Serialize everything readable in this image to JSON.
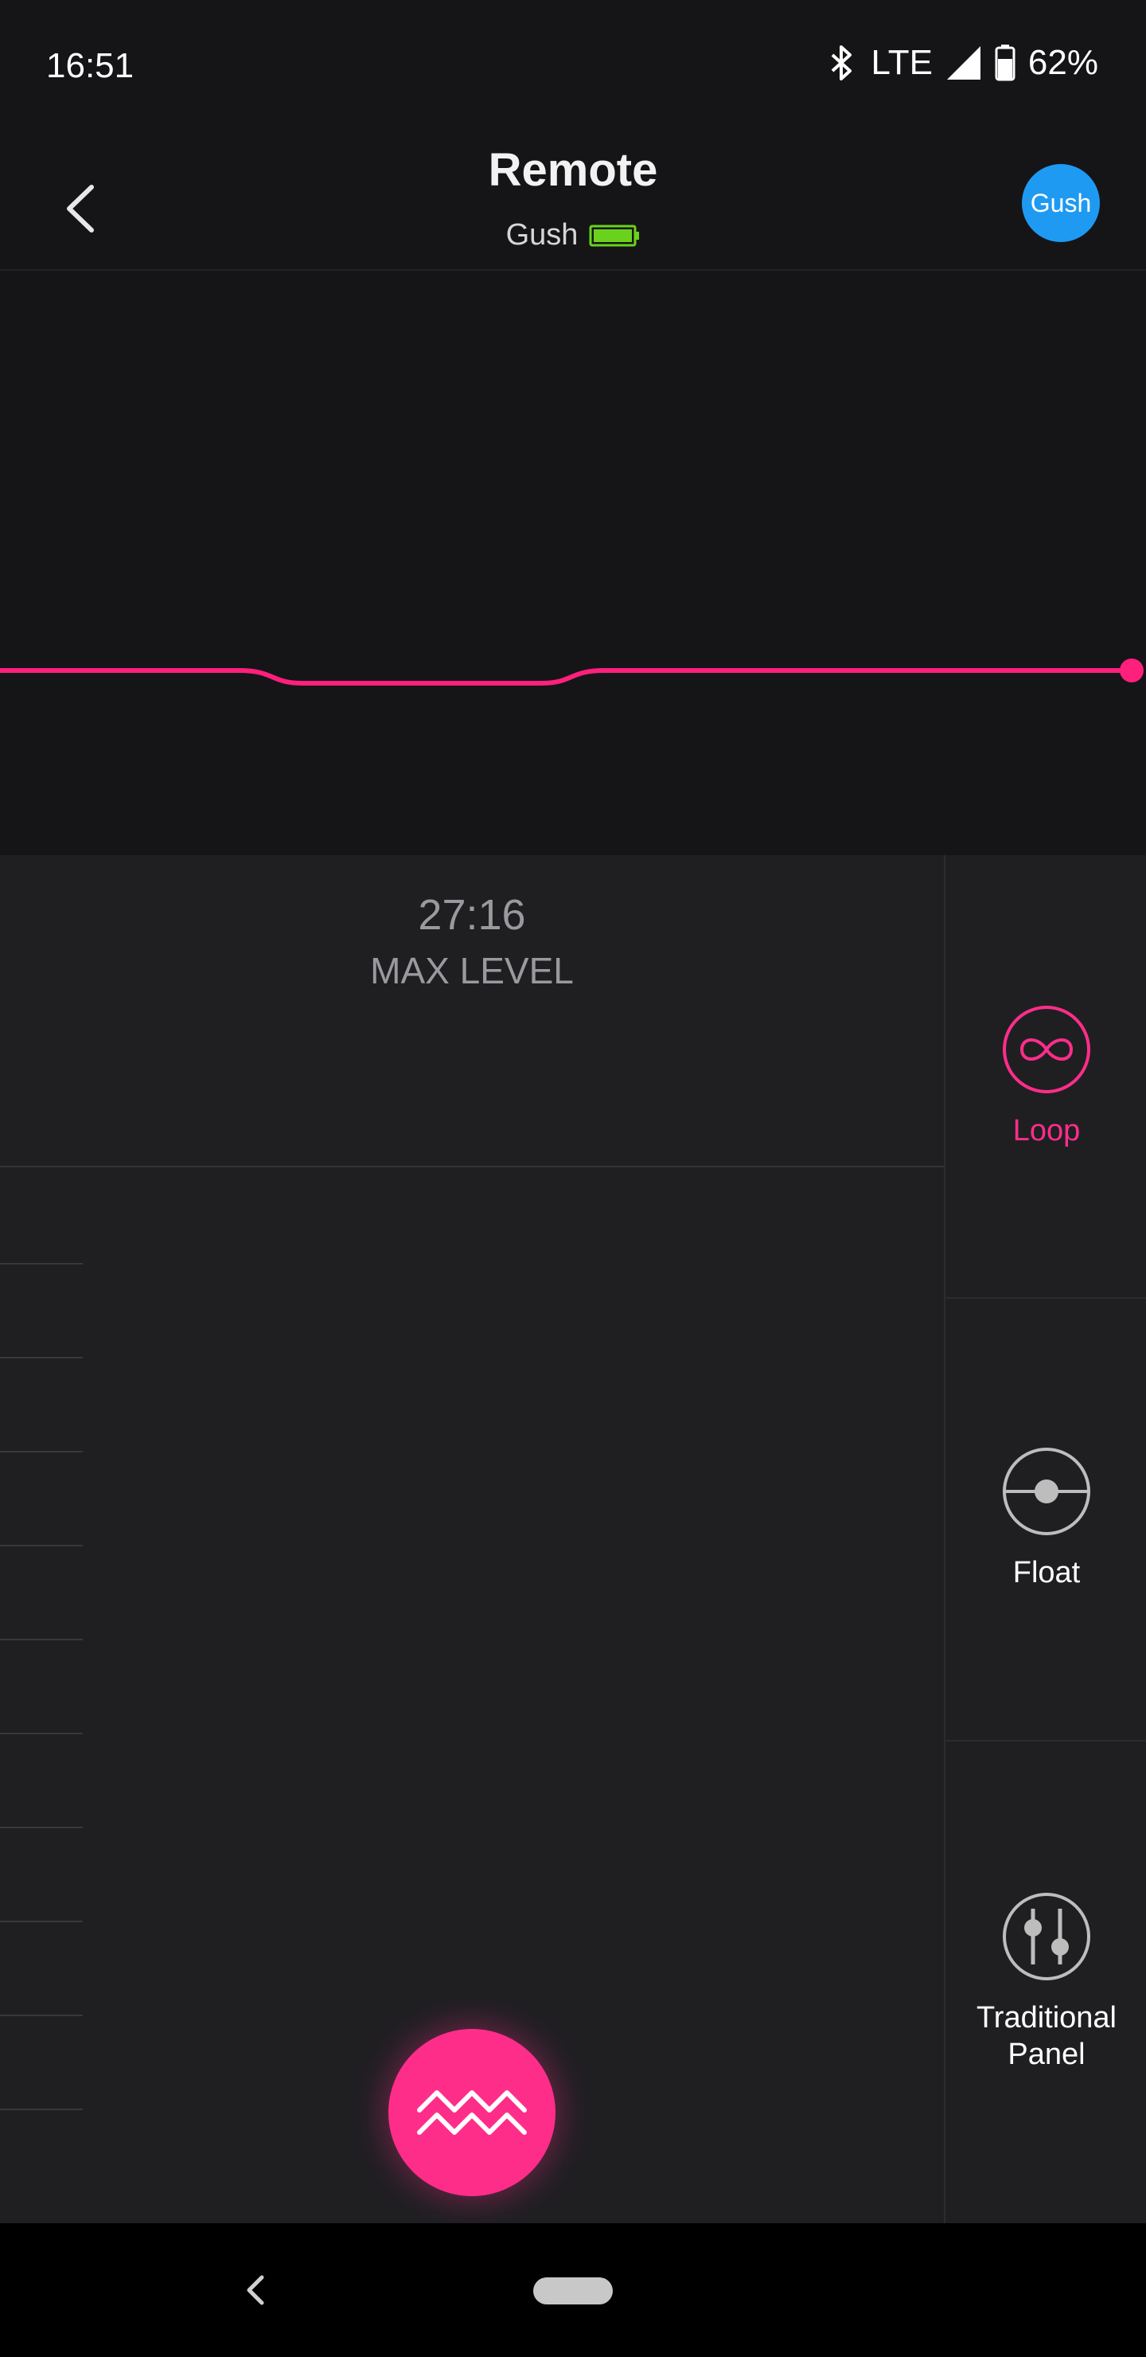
{
  "status_bar": {
    "time": "16:51",
    "network": "LTE",
    "battery": "62%"
  },
  "app_bar": {
    "title": "Remote",
    "device_name": "Gush",
    "avatar_label": "Gush"
  },
  "readout": {
    "time": "27:16",
    "label": "MAX LEVEL"
  },
  "modes": [
    {
      "label": "Loop",
      "active": true
    },
    {
      "label": "Float",
      "active": false
    },
    {
      "label": "Traditional\nPanel",
      "active": false
    }
  ],
  "colors": {
    "accent": "#ff2d8a",
    "inactive": "#9a9a9e",
    "battery": "#6ad21c",
    "avatar": "#1f9af2"
  },
  "icons": {
    "back": "chevron-left-icon",
    "fab": "waves-icon",
    "loop": "infinity-icon",
    "float": "float-icon",
    "panel": "sliders-icon"
  }
}
